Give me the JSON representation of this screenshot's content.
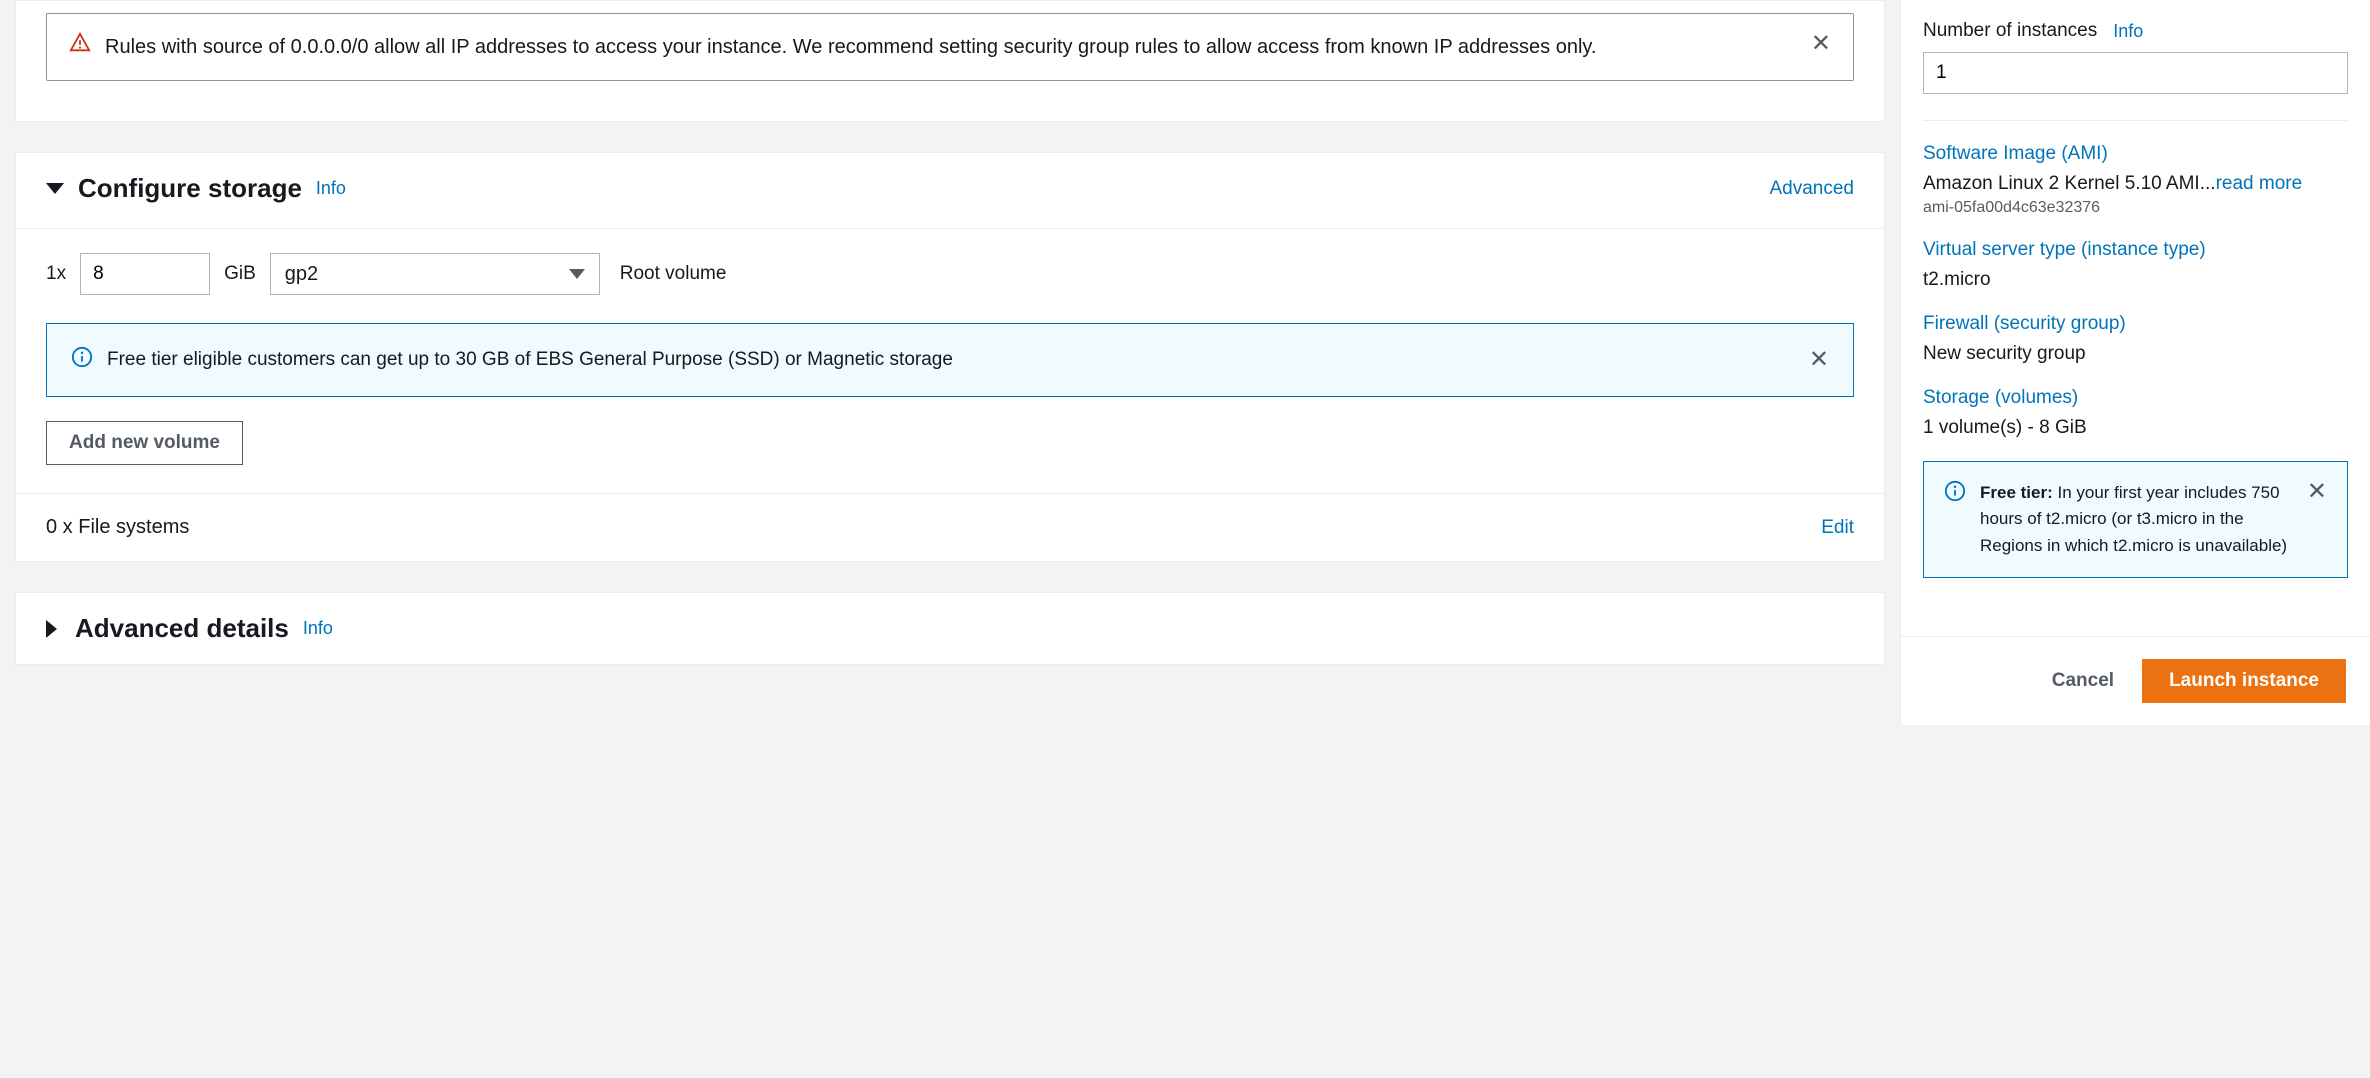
{
  "security_warning": {
    "text": "Rules with source of 0.0.0.0/0 allow all IP addresses to access your instance. We recommend setting security group rules to allow access from known IP addresses only."
  },
  "storage": {
    "title": "Configure storage",
    "info": "Info",
    "advanced": "Advanced",
    "multiplier": "1x",
    "size_value": "8",
    "size_unit": "GiB",
    "volume_type": "gp2",
    "root_label": "Root volume",
    "free_tier_msg": "Free tier eligible customers can get up to 30 GB of EBS General Purpose (SSD) or Magnetic storage",
    "add_volume": "Add new volume",
    "file_systems": "0 x File systems",
    "edit": "Edit"
  },
  "advanced_details": {
    "title": "Advanced details",
    "info": "Info"
  },
  "summary": {
    "num_instances_label": "Number of instances",
    "info": "Info",
    "num_instances_value": "1",
    "ami_label": "Software Image (AMI)",
    "ami_value": "Amazon Linux 2 Kernel 5.10 AMI...",
    "read_more": "read more",
    "ami_id": "ami-05fa00d4c63e32376",
    "instance_type_label": "Virtual server type (instance type)",
    "instance_type_value": "t2.micro",
    "firewall_label": "Firewall (security group)",
    "firewall_value": "New security group",
    "storage_label": "Storage (volumes)",
    "storage_value": "1 volume(s) - 8 GiB",
    "free_tier_bold": "Free tier:",
    "free_tier_text": " In your first year includes 750 hours of t2.micro (or t3.micro in the Regions in which t2.micro is unavailable)"
  },
  "buttons": {
    "cancel": "Cancel",
    "launch": "Launch instance"
  }
}
